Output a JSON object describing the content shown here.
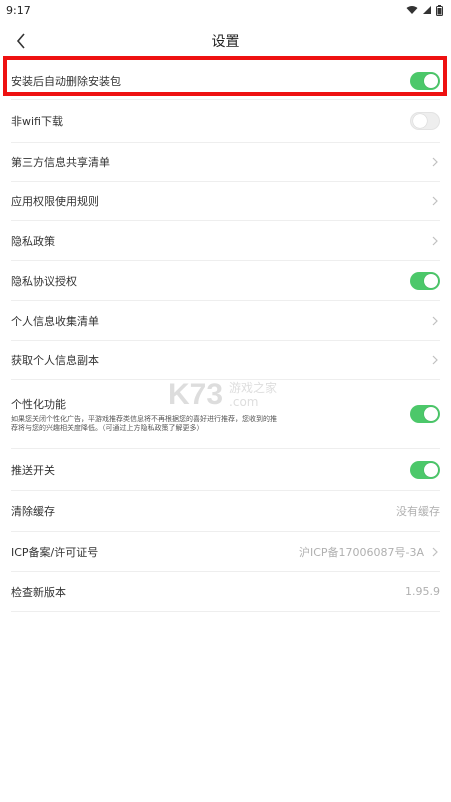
{
  "status_bar": {
    "time": "9:17"
  },
  "header": {
    "title": "设置"
  },
  "settings": [
    {
      "key": "auto_delete",
      "label": "安装后自动删除安装包",
      "toggle": true
    },
    {
      "key": "non_wifi",
      "label": "非wifi下载",
      "toggle": false
    },
    {
      "key": "third_party",
      "label": "第三方信息共享清单"
    },
    {
      "key": "permissions",
      "label": "应用权限使用规则"
    },
    {
      "key": "privacy_policy",
      "label": "隐私政策"
    },
    {
      "key": "privacy_auth",
      "label": "隐私协议授权",
      "toggle": true
    },
    {
      "key": "personal_info_list",
      "label": "个人信息收集清单"
    },
    {
      "key": "personal_info_copy",
      "label": "获取个人信息副本"
    },
    {
      "key": "personalization",
      "label": "个性化功能",
      "toggle": true,
      "description": "如果您关闭个性化广告，平游戏推荐类信息将不再根据您的喜好进行推荐，您收到的推荐将与您的兴趣相关度降低。（可通过上方隐私政策了解更多）"
    },
    {
      "key": "push",
      "label": "推送开关",
      "toggle": true
    },
    {
      "key": "clear_cache",
      "label": "清除缓存",
      "value": "没有缓存"
    },
    {
      "key": "icp",
      "label": "ICP备案/许可证号",
      "value": "沪ICP备17006087号-3A"
    },
    {
      "key": "version",
      "label": "检查新版本",
      "value": "1.95.9"
    }
  ],
  "watermark": {
    "mark": "K73",
    "text_cn": "游戏之家",
    "text_domain": ".com"
  },
  "colors": {
    "toggle_on": "#4cc86a",
    "highlight": "#ee1111"
  }
}
